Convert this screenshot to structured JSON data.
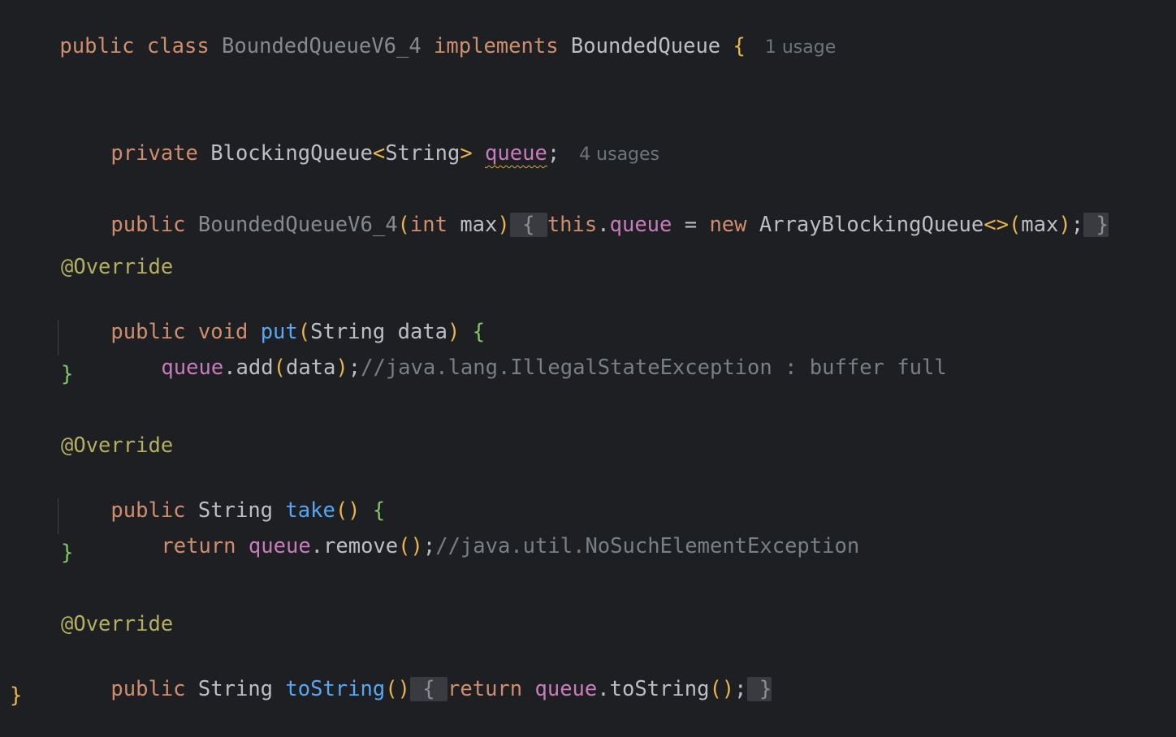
{
  "editor": {
    "lines": {
      "class_decl": {
        "kw_public": "public",
        "kw_class": "class",
        "class_name": "BoundedQueueV6_4",
        "kw_implements": "implements",
        "iface": "BoundedQueue",
        "open": "{",
        "hint": "1 usage"
      },
      "field": {
        "kw_private": "private",
        "type": "BlockingQueue",
        "lt": "<",
        "generic": "String",
        "gt": ">",
        "name": "queue",
        "semi": ";",
        "hint": "4 usages"
      },
      "ctor": {
        "kw_public": "public",
        "name": "BoundedQueueV6_4",
        "lparen": "(",
        "kw_int": "int",
        "param": "max",
        "rparen": ")",
        "fold_open": "{",
        "kw_this": "this",
        "dot": ".",
        "field": "queue",
        "assign": "=",
        "kw_new": "new",
        "type": "ArrayBlockingQueue",
        "diamond": "<>",
        "arg_open": "(",
        "arg": "max",
        "arg_close": ")",
        "semi": ";",
        "fold_close": "}"
      },
      "put_annotation": "@Override",
      "put_sig": {
        "kw_public": "public",
        "kw_void": "void",
        "name": "put",
        "lparen": "(",
        "ptype": "String",
        "pname": "data",
        "rparen": ")",
        "open": "{"
      },
      "put_body": {
        "field": "queue",
        "call": ".add",
        "lparen": "(",
        "arg": "data",
        "rparen": ")",
        "semi": ";",
        "comment": "//java.lang.IllegalStateException : buffer full"
      },
      "put_close": "}",
      "take_annotation": "@Override",
      "take_sig": {
        "kw_public": "public",
        "ret": "String",
        "name": "take",
        "parens": "()",
        "open": "{"
      },
      "take_body": {
        "kw_return": "return",
        "field": "queue",
        "call": ".remove",
        "parens": "()",
        "semi": ";",
        "comment": "//java.util.NoSuchElementException"
      },
      "take_close": "}",
      "tostring_annotation": "@Override",
      "tostring": {
        "kw_public": "public",
        "ret": "String",
        "name": "toString",
        "parens": "()",
        "fold_open": "{",
        "kw_return": "return",
        "field": "queue",
        "call": ".toString",
        "call_parens": "()",
        "semi": ";",
        "fold_close": "}"
      },
      "class_close": "}"
    }
  },
  "colors": {
    "background": "#1e1f22",
    "keyword": "#cf8e6d",
    "field": "#c77dbb",
    "method": "#56a8f5",
    "annotation": "#b3ae60",
    "comment": "#7a7e85",
    "text": "#bcbec4"
  }
}
